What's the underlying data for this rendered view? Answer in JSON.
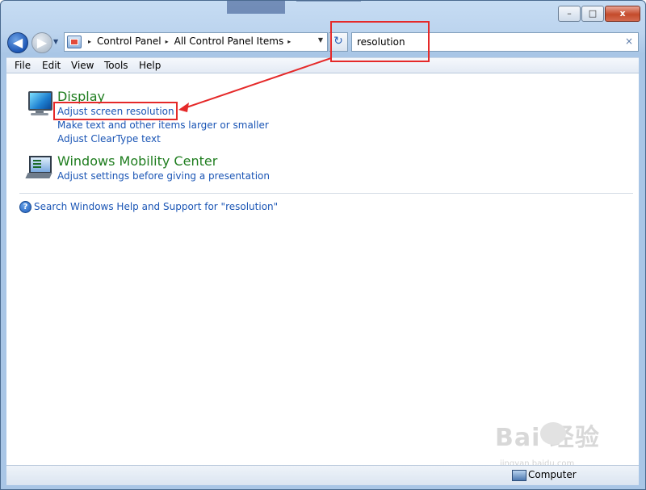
{
  "window": {
    "caption_buttons": {
      "minimize": "–",
      "maximize": "□",
      "close": "x"
    }
  },
  "nav": {
    "back_icon": "back-arrow-icon",
    "forward_icon": "forward-arrow-icon",
    "breadcrumbs": [
      "Control Panel",
      "All Control Panel Items"
    ],
    "separator": "▸",
    "search_value": "resolution",
    "clear_glyph": "×"
  },
  "menu": {
    "items": [
      "File",
      "Edit",
      "View",
      "Tools",
      "Help"
    ]
  },
  "results": {
    "display": {
      "title": "Display",
      "links": [
        "Adjust screen resolution",
        "Make text and other items larger or smaller",
        "Adjust ClearType text"
      ]
    },
    "mobility": {
      "title": "Windows Mobility Center",
      "links": [
        "Adjust settings before giving a presentation"
      ]
    },
    "help_link": "Search Windows Help and Support for \"resolution\""
  },
  "status": {
    "text": "Computer"
  },
  "watermark": {
    "text": "Bai  经验",
    "sub": "jingyan.baidu.com"
  },
  "colors": {
    "highlight": "#e52929",
    "link": "#1a55b5",
    "category": "#1e7d1e"
  }
}
